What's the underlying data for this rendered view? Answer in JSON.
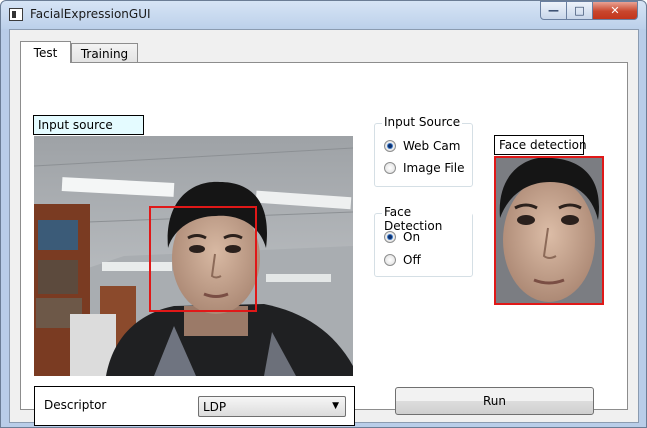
{
  "window": {
    "title": "FacialExpressionGUI",
    "caption_buttons": {
      "minimize": "—",
      "maximize": "□",
      "close": "✕"
    }
  },
  "tabs": [
    {
      "label": "Test",
      "selected": true
    },
    {
      "label": "Training",
      "selected": false
    }
  ],
  "test_panel": {
    "input_source_label": "Input source",
    "input_source_group": {
      "title": "Input Source",
      "options": [
        {
          "label": "Web Cam",
          "checked": true
        },
        {
          "label": "Image File",
          "checked": false
        }
      ]
    },
    "face_detection_group": {
      "title": "Face Detection",
      "options": [
        {
          "label": "On",
          "checked": true
        },
        {
          "label": "Off",
          "checked": false
        }
      ]
    },
    "face_detection_label": "Face detection",
    "descriptor": {
      "label": "Descriptor",
      "selected": "LDP"
    },
    "run_button": "Run"
  },
  "colors": {
    "detection_box": "#e01818",
    "input_label_bg": "#e4fbff"
  }
}
